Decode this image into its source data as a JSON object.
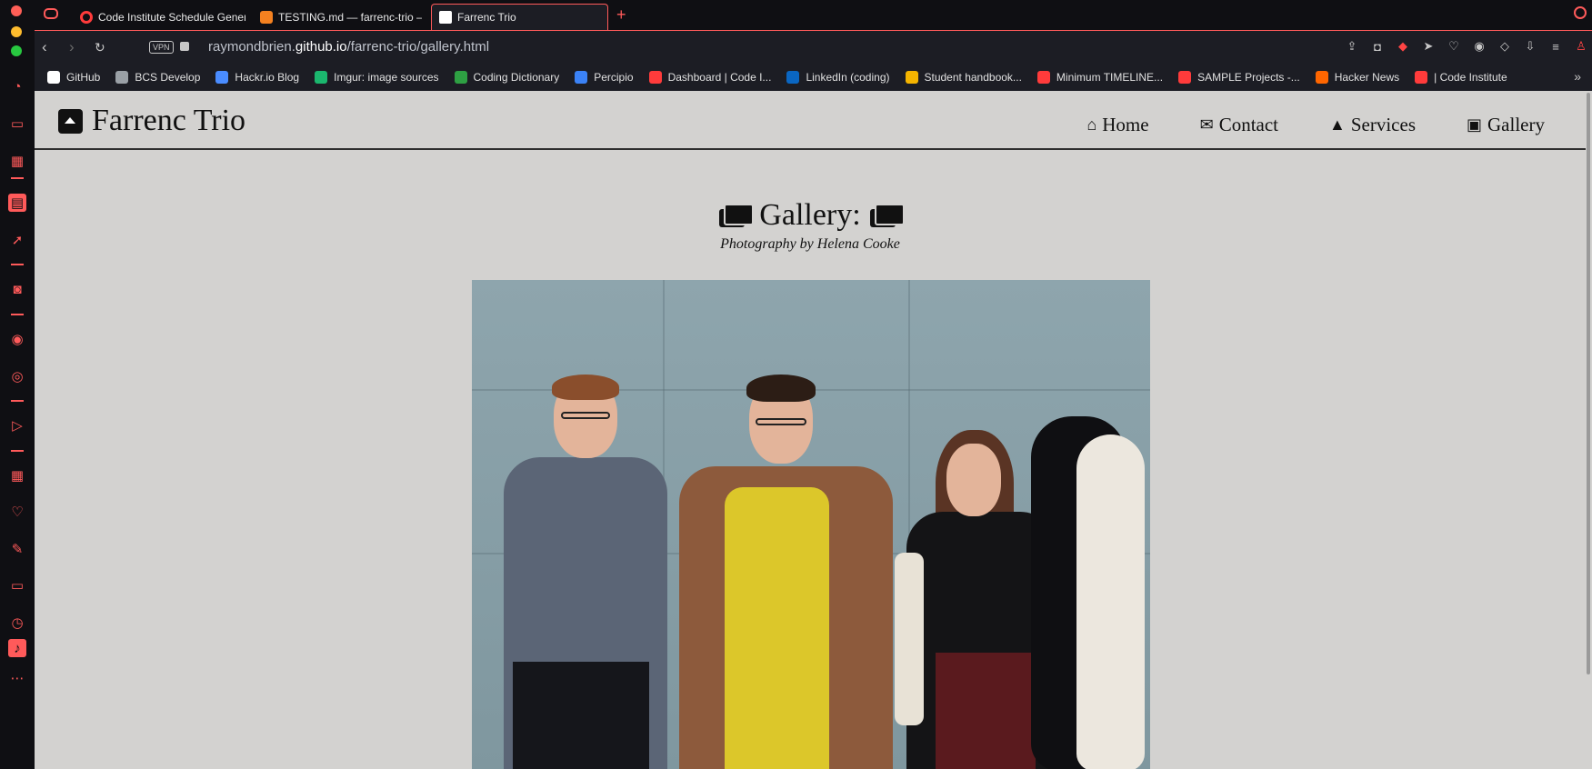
{
  "browser": {
    "tabs": [
      {
        "title": "Code Institute Schedule Genera",
        "active": false
      },
      {
        "title": "TESTING.md — farrenc-trio — G",
        "active": false
      },
      {
        "title": "Farrenc Trio",
        "active": true
      }
    ],
    "url": {
      "prefix": "raymondbrien.",
      "host": "github.io",
      "path": "/farrenc-trio/gallery.html"
    },
    "vpn_label": "VPN",
    "bookmarks": [
      {
        "label": "GitHub",
        "icon": "github-icon",
        "color": "#ffffff"
      },
      {
        "label": "BCS Develop",
        "icon": "bcs-icon",
        "color": "#9aa0a6"
      },
      {
        "label": "Hackr.io Blog",
        "icon": "hackr-icon",
        "color": "#4a8cff"
      },
      {
        "label": "Imgur: image sources",
        "icon": "imgur-icon",
        "color": "#1bb76e"
      },
      {
        "label": "Coding Dictionary",
        "icon": "wordpress-icon",
        "color": "#2ea043"
      },
      {
        "label": "Percipio",
        "icon": "percipio-icon",
        "color": "#3b82f6"
      },
      {
        "label": "Dashboard | Code I...",
        "icon": "codeinstitute-icon",
        "color": "#ff3b3b"
      },
      {
        "label": "LinkedIn (coding)",
        "icon": "linkedin-icon",
        "color": "#0a66c2"
      },
      {
        "label": "Student handbook...",
        "icon": "drive-icon",
        "color": "#f4b400"
      },
      {
        "label": "Minimum TIMELINE...",
        "icon": "codeinstitute-icon",
        "color": "#ff3b3b"
      },
      {
        "label": "SAMPLE Projects -...",
        "icon": "codeinstitute-icon",
        "color": "#ff3b3b"
      },
      {
        "label": "Hacker News",
        "icon": "ycombinator-icon",
        "color": "#ff6600"
      },
      {
        "label": "| Code Institute",
        "icon": "codeinstitute-icon",
        "color": "#ff3b3b"
      }
    ],
    "more_bookmarks": "»",
    "accent_color": "#ff5a5a"
  },
  "site": {
    "brand": "Farrenc Trio",
    "nav": [
      {
        "label": "Home",
        "icon": "home-icon",
        "glyph": "⌂"
      },
      {
        "label": "Contact",
        "icon": "envelope-icon",
        "glyph": "✉"
      },
      {
        "label": "Services",
        "icon": "bell-concierge-icon",
        "glyph": "▲"
      },
      {
        "label": "Gallery",
        "icon": "images-icon",
        "glyph": "▣"
      }
    ],
    "page_heading": "Gallery:",
    "page_subtitle": "Photography by Helena Cooke",
    "background_color": "#d3d2d0"
  }
}
